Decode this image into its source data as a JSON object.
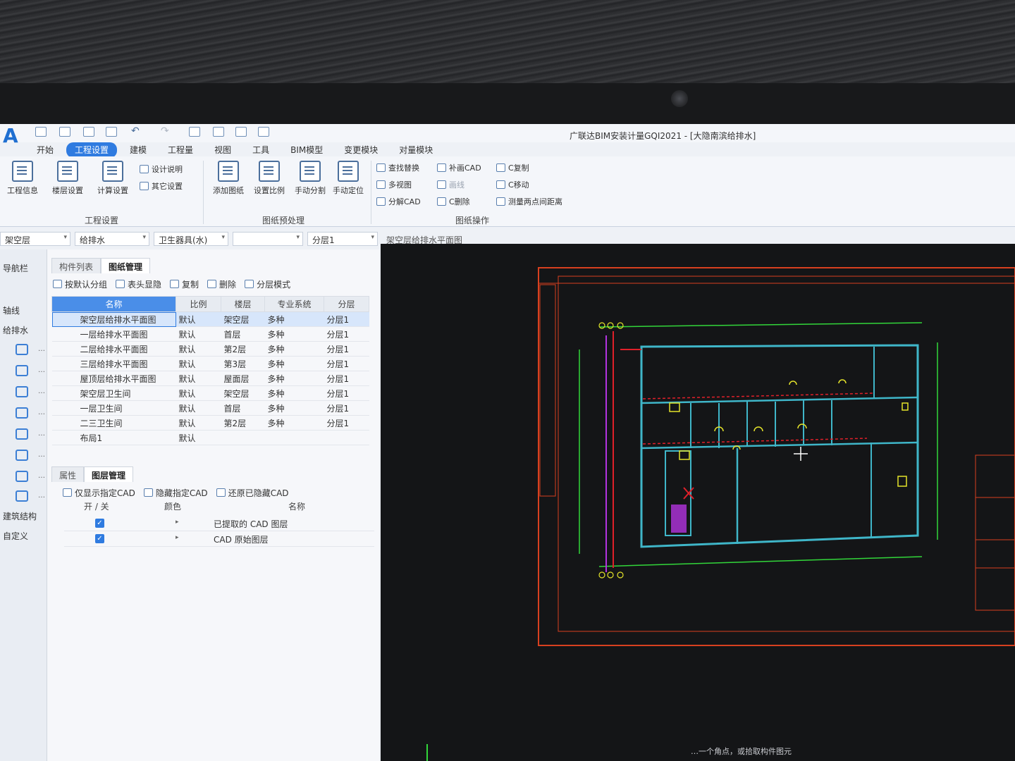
{
  "app": {
    "window_title": "广联达BIM安装计量GQI2021 - [大隐南滨给排水]",
    "logo_letter": "A"
  },
  "menu_tabs": [
    "开始",
    "工程设置",
    "建模",
    "工程量",
    "视图",
    "工具",
    "BIM模型",
    "变更模块",
    "对量模块"
  ],
  "ribbon": {
    "project_settings": {
      "buttons": [
        "工程信息",
        "楼层设置",
        "计算设置"
      ],
      "small": [
        "设计说明",
        "其它设置"
      ],
      "group_label": "工程设置"
    },
    "drawing_preprocess": {
      "buttons": [
        "添加图纸",
        "设置比例",
        "手动分割",
        "手动定位"
      ],
      "group_label": "图纸预处理"
    },
    "drawing_ops": {
      "col1": [
        "查找替换",
        "多视图",
        "分解CAD"
      ],
      "col2": [
        "补画CAD",
        "画线",
        "C删除"
      ],
      "col3": [
        "C复制",
        "C移动",
        "测量两点间距离"
      ],
      "group_label": "图纸操作"
    }
  },
  "combobar": {
    "floor": "架空层",
    "specialty": "给排水",
    "component": "卫生器具(水)",
    "blank": "",
    "layer": "分层1",
    "drawing": "架空层给排水平面图"
  },
  "leftnav": {
    "title": "导航栏",
    "axis": "轴线",
    "specialty": "给排水",
    "building": "建筑结构",
    "custom": "自定义",
    "more": "…"
  },
  "drawing_panel": {
    "tabs": [
      "构件列表",
      "图纸管理"
    ],
    "toolbar": [
      "按默认分组",
      "表头显隐",
      "复制",
      "删除",
      "分层模式"
    ],
    "columns": [
      "名称",
      "比例",
      "楼层",
      "专业系统",
      "分层"
    ],
    "rows": [
      {
        "name": "架空层给排水平面图",
        "scale": "默认",
        "floor": "架空层",
        "system": "多种",
        "layer": "分层1"
      },
      {
        "name": "一层给排水平面图",
        "scale": "默认",
        "floor": "首层",
        "system": "多种",
        "layer": "分层1"
      },
      {
        "name": "二层给排水平面图",
        "scale": "默认",
        "floor": "第2层",
        "system": "多种",
        "layer": "分层1"
      },
      {
        "name": "三层给排水平面图",
        "scale": "默认",
        "floor": "第3层",
        "system": "多种",
        "layer": "分层1"
      },
      {
        "name": "屋顶层给排水平面图",
        "scale": "默认",
        "floor": "屋面层",
        "system": "多种",
        "layer": "分层1"
      },
      {
        "name": "架空层卫生间",
        "scale": "默认",
        "floor": "架空层",
        "system": "多种",
        "layer": "分层1"
      },
      {
        "name": "一层卫生间",
        "scale": "默认",
        "floor": "首层",
        "system": "多种",
        "layer": "分层1"
      },
      {
        "name": "二三卫生间",
        "scale": "默认",
        "floor": "第2层",
        "system": "多种",
        "layer": "分层1"
      },
      {
        "name": "布局1",
        "scale": "默认",
        "floor": "",
        "system": "",
        "layer": ""
      }
    ]
  },
  "layer_panel": {
    "tabs": [
      "属性",
      "图层管理"
    ],
    "toolbar": [
      "仅显示指定CAD",
      "隐藏指定CAD",
      "还原已隐藏CAD"
    ],
    "columns": [
      "开 / 关",
      "颜色",
      "名称"
    ],
    "rows": [
      {
        "on": true,
        "name": "已提取的 CAD 图层"
      },
      {
        "on": true,
        "name": "CAD 原始图层"
      }
    ]
  },
  "status": {
    "hint": "…一个角点，或拾取构件图元"
  },
  "colors": {
    "accent": "#2f7be0",
    "cad_background": "#141517",
    "cad_frame": "#d8401f",
    "wall_cyan": "#3fb6c9",
    "axis_green": "#32d63a",
    "pipe_red": "#e0202a",
    "pipe_magenta": "#b333e0",
    "marker_yellow": "#e4e32a"
  }
}
